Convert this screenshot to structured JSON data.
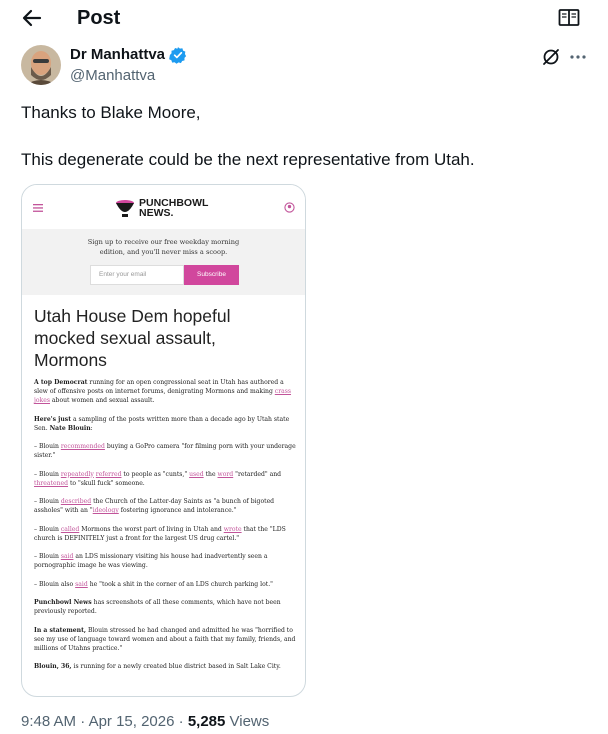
{
  "header": {
    "title": "Post"
  },
  "author": {
    "name": "Dr Manhattva",
    "handle": "@Manhattva",
    "verified_color": "#1d9bf0"
  },
  "tweet": {
    "line1": "Thanks to Blake Moore,",
    "line2": "This degenerate could be the next representative from Utah."
  },
  "article": {
    "publisher_line1": "PUNCHBOWL",
    "publisher_line2": "NEWS.",
    "signup_text": "Sign up to receive our free weekday morning edition, and you'll never miss a scoop.",
    "email_placeholder": "Enter your email",
    "subscribe_label": "Subscribe",
    "headline": "Utah House Dem hopeful mocked sexual assault, Mormons",
    "p1_bold": "A top Democrat",
    "p1_a": " running for an open congressional seat in Utah has authored a slew of offensive posts on internet forums, denigrating Mormons and making ",
    "p1_link1": "crass",
    "p1_sp": " ",
    "p1_link2": "jokes",
    "p1_b": " about women and sexual assault.",
    "p2_bold1": "Here's just",
    "p2_a": " a sampling of the posts written more than a decade ago by Utah state Sen. ",
    "p2_bold2": "Nate Blouin",
    "p2_b": ":",
    "b1_a": "– Blouin ",
    "b1_link": "recommended",
    "b1_b": " buying a GoPro camera \"for filming porn with your underage sister.\"",
    "b2_a": "– Blouin ",
    "b2_link1": "repeatedly",
    "b2_sp1": " ",
    "b2_link2": "referred",
    "b2_b": " to people as \"cunts,\" ",
    "b2_link3": "used",
    "b2_c": " the ",
    "b2_link4": "word",
    "b2_d": " \"retarded\" and ",
    "b2_link5": "threatened",
    "b2_e": " to \"skull fuck\" someone.",
    "b3_a": "– Blouin ",
    "b3_link1": "described",
    "b3_b": " the Church of the Latter-day Saints as \"a bunch of bigoted assholes\" with an \"",
    "b3_link2": "ideology",
    "b3_c": " fostering ignorance and intolerance.\"",
    "b4_a": "– Blouin ",
    "b4_link1": "called",
    "b4_b": " Mormons the worst part of living in Utah and ",
    "b4_link2": "wrote",
    "b4_c": " that the \"LDS church is DEFINITELY just a front for the largest US drug cartel.\"",
    "b5_a": "– Blouin ",
    "b5_link": "said",
    "b5_b": " an LDS missionary visiting his house had inadvertently seen a pornographic image he was viewing.",
    "b6_a": "– Blouin also ",
    "b6_link": "said",
    "b6_b": " he \"took a shit in the corner of an LDS church parking lot.\"",
    "p3_bold": "Punchbowl News",
    "p3_a": " has screenshots of all these comments, which have not been previously reported.",
    "p4_bold": "In a statement,",
    "p4_a": " Blouin stressed he had changed and admitted he was \"horrified to see my use of language toward women and about a faith that my family, friends, and millions of Utahns practice.\"",
    "p5_bold": "Blouin, 36,",
    "p5_a": " is running for a newly created blue district based in Salt Lake City.",
    "accent_color": "#d1479d"
  },
  "meta": {
    "time": "9:48 AM",
    "sep1": " · ",
    "date": "Apr 15, 2026",
    "sep2": " · ",
    "views_count": "5,285",
    "views_label": " Views"
  }
}
